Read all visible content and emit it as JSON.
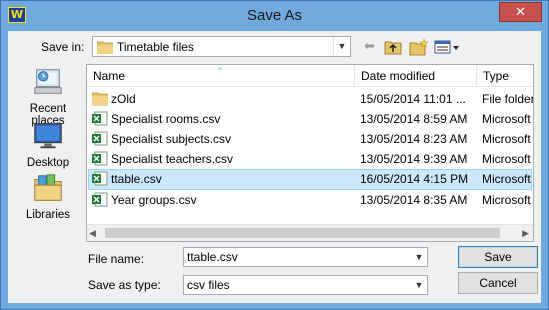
{
  "window": {
    "title": "Save As",
    "app_icon": "W",
    "close_glyph": "✕"
  },
  "toolbar": {
    "save_in_label": "Save in:",
    "save_in_value": "Timetable files",
    "back_glyph": "⬅"
  },
  "places": [
    {
      "label": "Recent places",
      "icon": "recent-places-icon"
    },
    {
      "label": "Desktop",
      "icon": "desktop-icon"
    },
    {
      "label": "Libraries",
      "icon": "libraries-icon"
    }
  ],
  "columns": {
    "name": "Name",
    "date": "Date modified",
    "type": "Type",
    "sort_glyph": "^"
  },
  "files": [
    {
      "name": "zOld",
      "date": "15/05/2014 11:01 ...",
      "type": "File folder",
      "icon": "folder-icon",
      "selected": false
    },
    {
      "name": "Specialist rooms.csv",
      "date": "13/05/2014 8:59 AM",
      "type": "Microsoft",
      "icon": "excel-icon",
      "selected": false
    },
    {
      "name": "Specialist subjects.csv",
      "date": "13/05/2014 8:23 AM",
      "type": "Microsoft",
      "icon": "excel-icon",
      "selected": false
    },
    {
      "name": "Specialist teachers.csv",
      "date": "13/05/2014 9:39 AM",
      "type": "Microsoft",
      "icon": "excel-icon",
      "selected": false
    },
    {
      "name": "ttable.csv",
      "date": "16/05/2014 4:15 PM",
      "type": "Microsoft",
      "icon": "excel-icon",
      "selected": true
    },
    {
      "name": "Year groups.csv",
      "date": "13/05/2014 8:35 AM",
      "type": "Microsoft",
      "icon": "excel-icon",
      "selected": false
    }
  ],
  "form": {
    "file_name_label": "File name:",
    "file_name_value": "ttable.csv",
    "save_as_type_label": "Save as type:",
    "save_as_type_value": "csv files"
  },
  "buttons": {
    "save": "Save",
    "cancel": "Cancel"
  },
  "colors": {
    "title_bar": "#6fa9dd",
    "selection": "#cce8ff",
    "close": "#c7504c"
  }
}
